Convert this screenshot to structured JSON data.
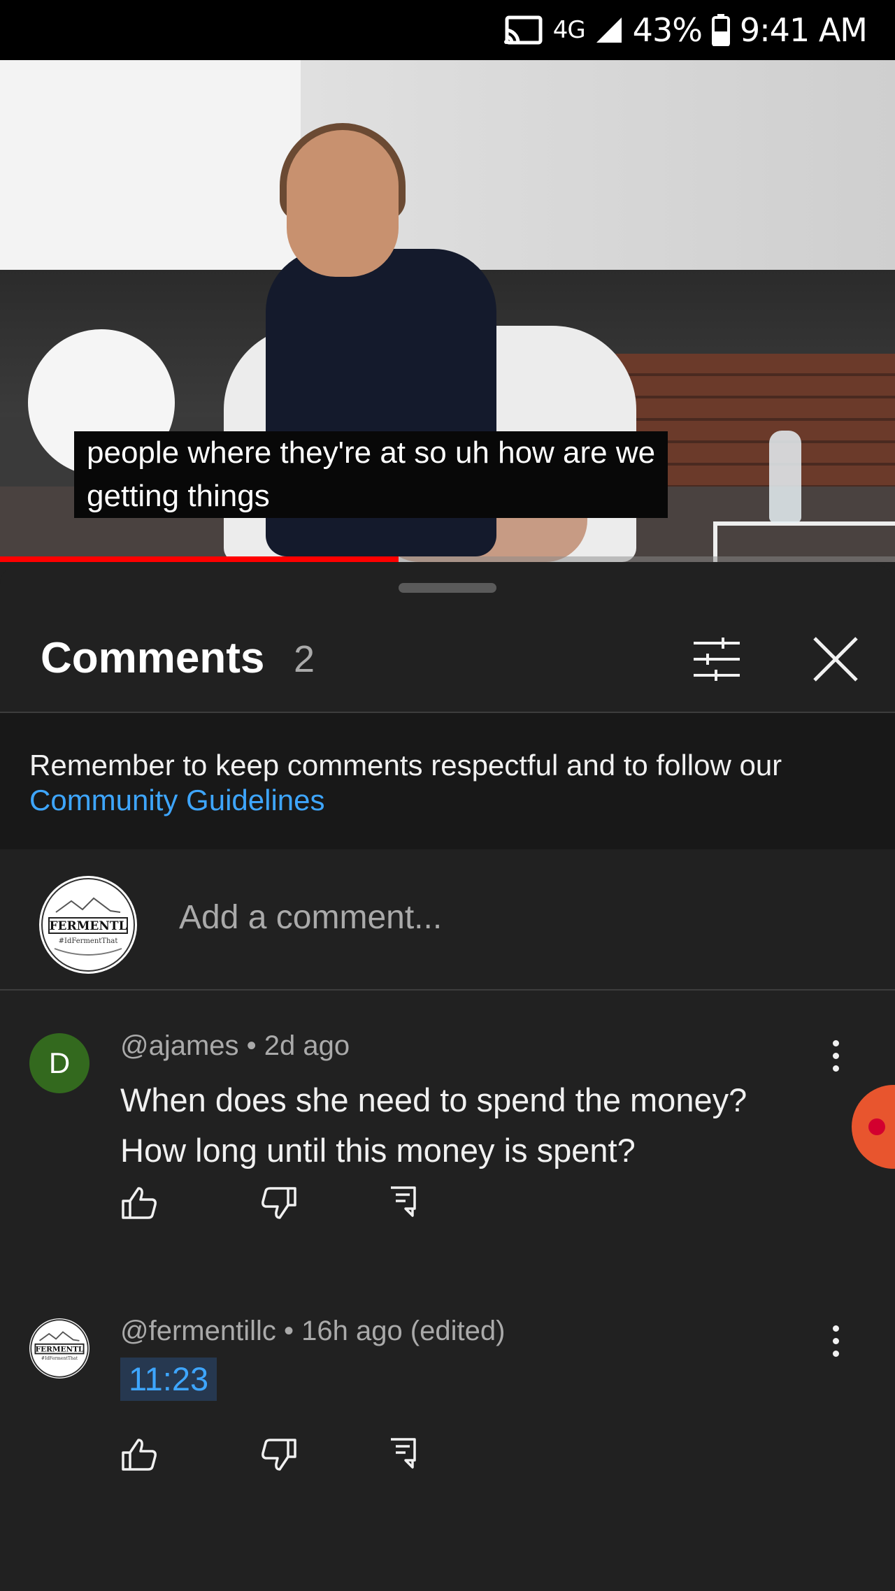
{
  "status_bar": {
    "network": "4G",
    "battery": "43%",
    "time": "9:41 AM",
    "icons": [
      "cast-icon",
      "signal-icon",
      "battery-icon"
    ]
  },
  "video": {
    "caption_line1": "people where they're at so uh how are we",
    "caption_line2": "getting things",
    "progress_fraction": 0.445
  },
  "comments_panel": {
    "title": "Comments",
    "count": "2",
    "notice_text": "Remember to keep comments respectful and to follow our ",
    "notice_link": "Community Guidelines",
    "add_placeholder": "Add a comment...",
    "channel_logo_text": "FERMENTL",
    "channel_logo_sub": "#IdFermentThat"
  },
  "comments": [
    {
      "avatar_letter": "D",
      "avatar_color": "#33691e",
      "meta": "@ajames • 2d ago",
      "text": "When does she need to spend the money? How long until this money is spent?"
    },
    {
      "meta": "@fermentillc • 16h ago (edited)",
      "timestamp_link": "11:23"
    }
  ],
  "colors": {
    "accent_link": "#3ea6ff",
    "progress": "#ff0000",
    "background": "#212121"
  }
}
